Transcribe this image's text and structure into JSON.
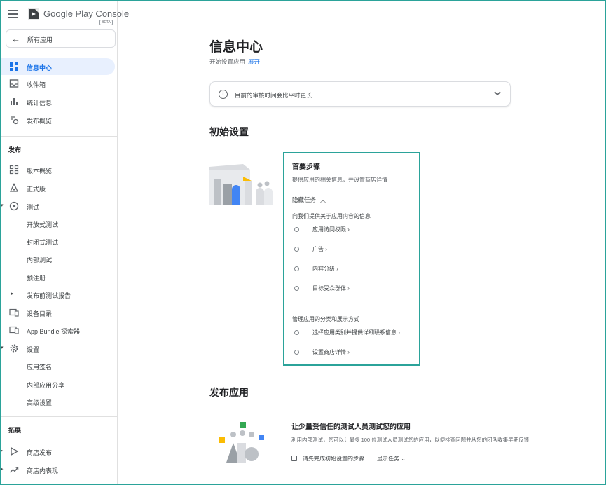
{
  "app": {
    "logo_text": "Google Play Console",
    "beta": "BETA"
  },
  "sidebar": {
    "all_apps": "所有应用",
    "top_items": [
      {
        "label": "信息中心",
        "icon": "dashboard-icon",
        "active": true
      },
      {
        "label": "收件箱",
        "icon": "inbox-icon"
      },
      {
        "label": "统计信息",
        "icon": "bar-chart-icon"
      },
      {
        "label": "发布概览",
        "icon": "publishing-overview-icon"
      }
    ],
    "release_section": "发布",
    "release_items": [
      {
        "label": "版本概览",
        "icon": "grid-icon"
      },
      {
        "label": "正式版",
        "icon": "production-icon"
      },
      {
        "label": "测试",
        "icon": "play-circle-icon"
      },
      {
        "label": "开放式测试"
      },
      {
        "label": "封闭式测试"
      },
      {
        "label": "内部测试"
      },
      {
        "label": "预注册"
      },
      {
        "label": "发布前测试报告"
      },
      {
        "label": "设备目录",
        "icon": "devices-icon"
      },
      {
        "label": "App Bundle 探索器",
        "icon": "bundle-icon"
      },
      {
        "label": "设置",
        "icon": "gear-icon"
      },
      {
        "label": "应用签名"
      },
      {
        "label": "内部应用分享"
      },
      {
        "label": "高级设置"
      }
    ],
    "grow_section": "拓展",
    "grow_items": [
      {
        "label": "商店发布",
        "icon": "store-icon"
      },
      {
        "label": "商店内表现",
        "icon": "trending-icon"
      }
    ]
  },
  "main": {
    "title": "信息中心",
    "subtitle": "开始设置应用",
    "expand": "展开",
    "notice": "目前的审核时间会比平时更长",
    "section_initial": "初始设置",
    "steps": {
      "title": "首要步骤",
      "description": "提供应用的相关信息，并设置商店详情",
      "hide_tasks": "隐藏任务",
      "group1_label": "向我们提供关于应用内容的信息",
      "group1_tasks": [
        "应用访问权限 ›",
        "广告 ›",
        "内容分级 ›",
        "目标受众群体 ›"
      ],
      "group2_label": "管理应用的分类和展示方式",
      "group2_tasks": [
        "选择应用类别并提供详细联系信息 ›",
        "设置商店详情 ›"
      ]
    },
    "section_publish": "发布应用",
    "publish": {
      "title": "让少量受信任的测试人员测试您的应用",
      "description": "利用内部测试，您可以让最多 100 位测试人员测试您的应用，以便排查问题并从您的团队收集早期反馈",
      "locked_note": "请先完成初始设置的步骤",
      "show_tasks": "显示任务"
    }
  },
  "colors": {
    "accent": "#1a73e8",
    "highlight_border": "#2ba39a",
    "active_bg": "#e8f0fe"
  }
}
